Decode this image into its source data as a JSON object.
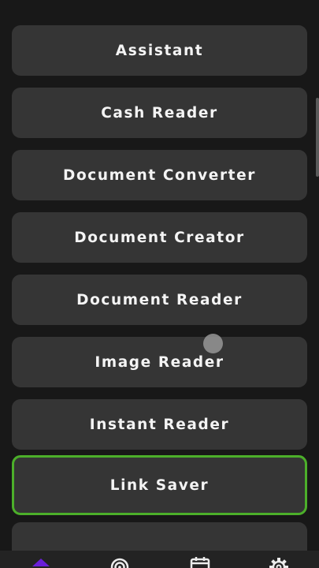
{
  "menu": {
    "items": [
      {
        "label": "Assistant"
      },
      {
        "label": "Cash Reader"
      },
      {
        "label": "Document Converter"
      },
      {
        "label": "Document Creator"
      },
      {
        "label": "Document Reader"
      },
      {
        "label": "Image Reader"
      },
      {
        "label": "Instant Reader"
      },
      {
        "label": "Link Saver",
        "focused": true
      },
      {
        "label": ""
      }
    ]
  },
  "colors": {
    "background": "#181818",
    "item_background": "#353535",
    "focus_border": "#4caf2a",
    "accent": "#6a1fd8"
  },
  "bottom_nav": {
    "icons": [
      "home-icon",
      "radar-icon",
      "calendar-icon",
      "gear-icon"
    ],
    "active": "home-icon"
  }
}
